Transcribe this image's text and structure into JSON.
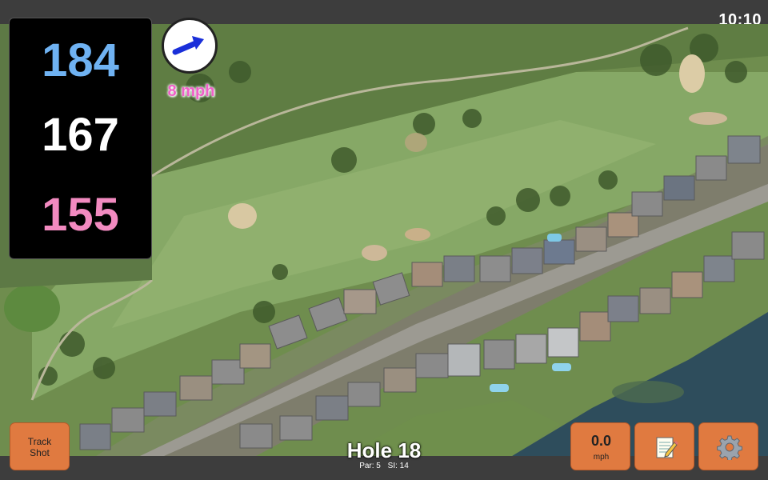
{
  "status_bar": {
    "time": "10:10"
  },
  "distances": {
    "back": "184",
    "middle": "167",
    "front": "155"
  },
  "wind": {
    "speed": "8 mph",
    "icon": "wind-direction-arrow-icon"
  },
  "buttons": {
    "track_shot": {
      "line1": "Track",
      "line2": "Shot"
    },
    "shot_speed": {
      "value": "0.0",
      "unit": "mph"
    },
    "notes": {
      "icon": "notepad-icon"
    },
    "settings": {
      "icon": "gear-icon"
    }
  },
  "hole": {
    "title": "Hole 18",
    "par": "Par: 5",
    "stroke_index": "SI: 14"
  },
  "colors": {
    "back_distance": "#6fb2f2",
    "middle_distance": "#ffffff",
    "front_distance": "#f28ac0",
    "wind_text": "#f060c8",
    "button": "#e07a40",
    "arrow": "#1a2fd9"
  }
}
